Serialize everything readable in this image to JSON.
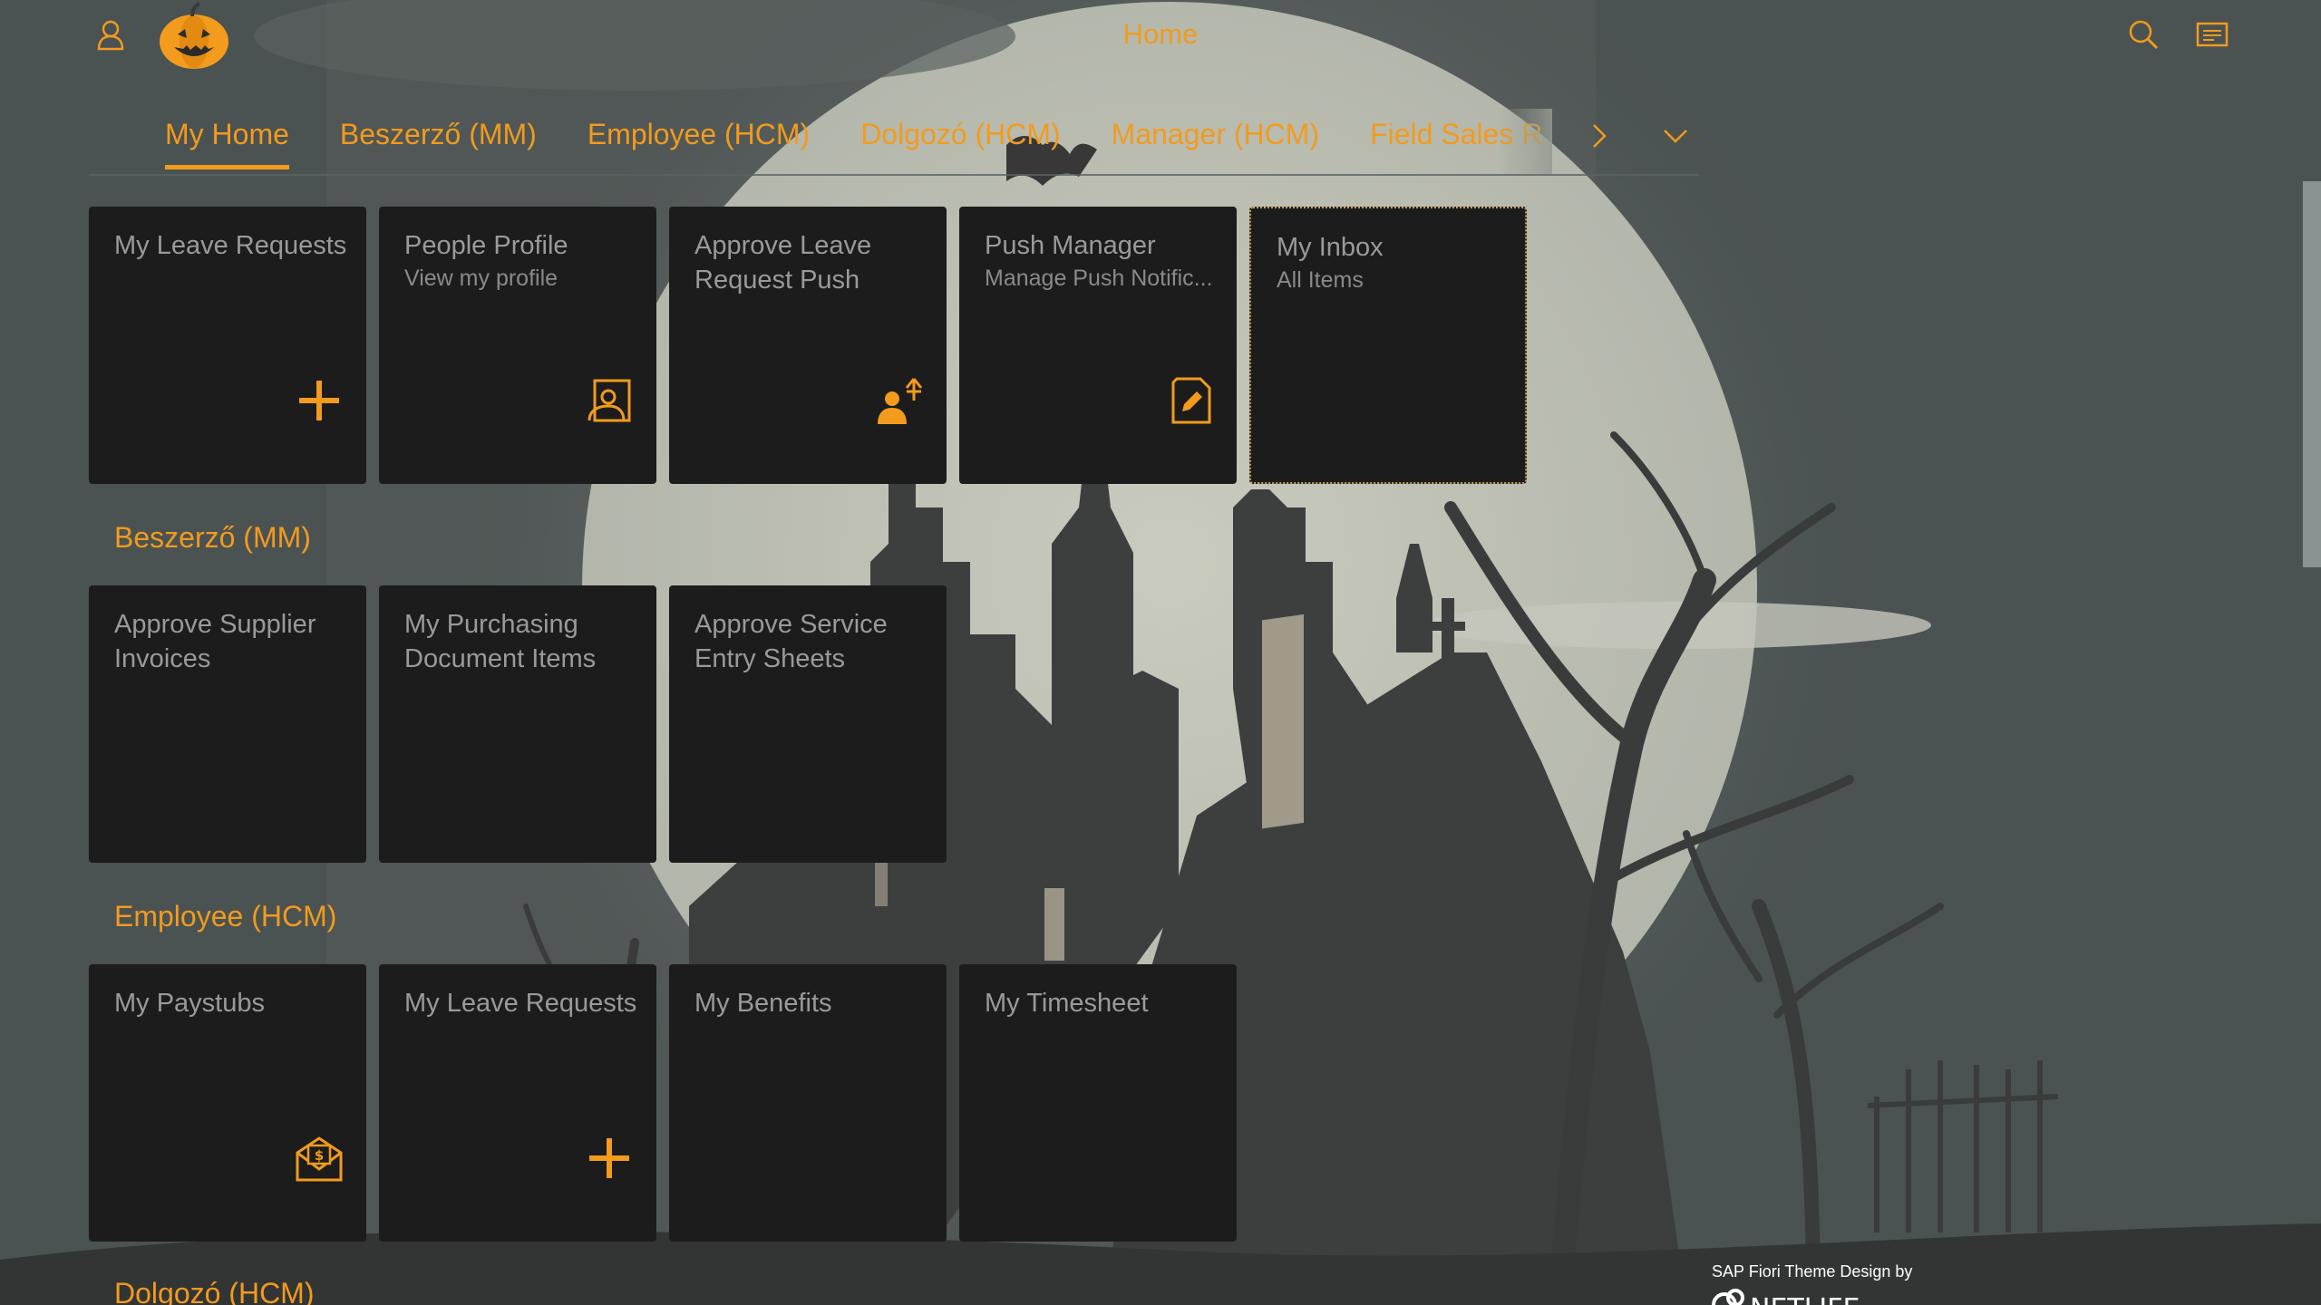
{
  "header": {
    "title": "Home",
    "icons": {
      "user": "user-icon",
      "logo": "pumpkin-logo",
      "search": "search-icon",
      "menu": "menu-icon"
    },
    "accent_color": "#f29b1d"
  },
  "anchor_bar": {
    "items": [
      {
        "label": "My Home",
        "selected": true
      },
      {
        "label": "Beszerző (MM)"
      },
      {
        "label": "Employee (HCM)"
      },
      {
        "label": "Dolgozó (HCM)"
      },
      {
        "label": "Manager (HCM)"
      },
      {
        "label": "Field Sales R"
      }
    ],
    "overflow_icons": [
      "chevron-right-icon",
      "chevron-down-icon"
    ]
  },
  "groups": [
    {
      "title": "",
      "tiles": [
        {
          "title": "My Leave Requests",
          "icon": "add-icon"
        },
        {
          "title": "People Profile",
          "subtitle": "View my profile",
          "icon": "person-card-icon"
        },
        {
          "title": "Approve Leave Request Push",
          "icon": "person-travel-icon"
        },
        {
          "title": "Push Manager",
          "subtitle": "Manage Push Notific...",
          "icon": "document-edit-icon"
        },
        {
          "title": "My Inbox",
          "subtitle": "All Items",
          "focused": true
        }
      ]
    },
    {
      "title": "Beszerző (MM)",
      "tiles": [
        {
          "title": "Approve Supplier Invoices"
        },
        {
          "title": "My Purchasing Document Items"
        },
        {
          "title": "Approve Service Entry Sheets"
        }
      ]
    },
    {
      "title": "Employee (HCM)",
      "tiles": [
        {
          "title": "My Paystubs",
          "icon": "paystub-envelope-icon"
        },
        {
          "title": "My Leave Requests",
          "icon": "add-icon"
        },
        {
          "title": "My Benefits"
        },
        {
          "title": "My Timesheet"
        }
      ]
    },
    {
      "title": "Dolgozó (HCM)"
    }
  ],
  "footer": {
    "credit": "SAP Fiori Theme Design by",
    "brand": "NETLIFE"
  }
}
